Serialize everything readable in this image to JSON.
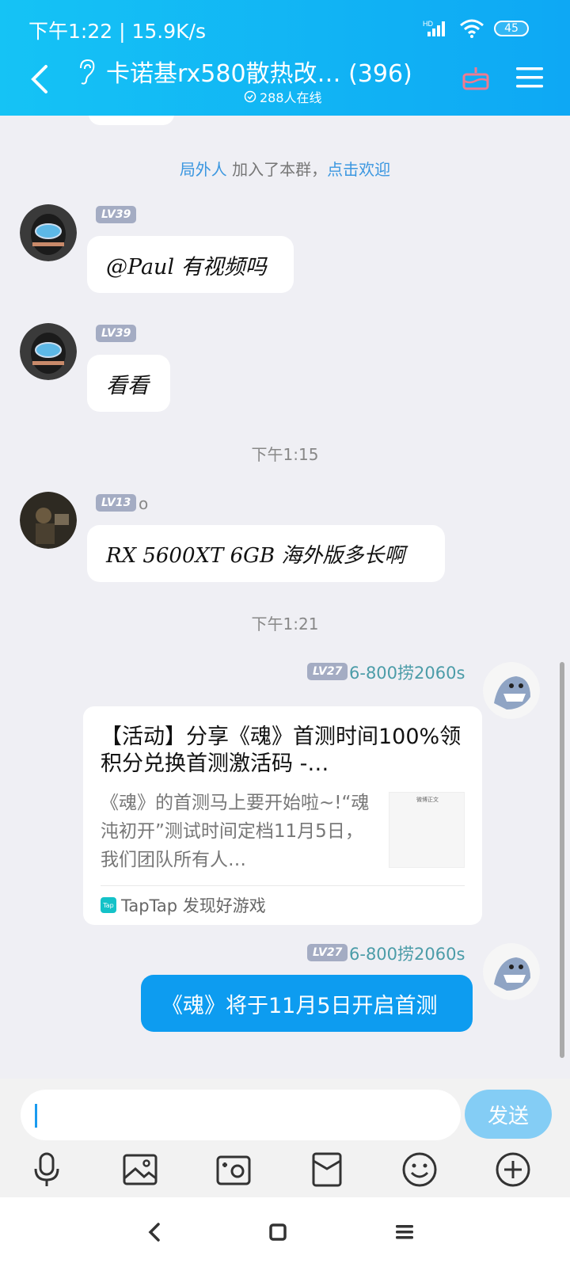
{
  "status": {
    "time_speed": "下午1:22 | 15.9K/s",
    "battery": "45",
    "signal": "HD"
  },
  "header": {
    "title": "卡诺基rx580散热改… (396)",
    "online": "288人在线"
  },
  "system_message": {
    "user": "局外人",
    "text": " 加入了本群，",
    "action": "点击欢迎"
  },
  "messages": [
    {
      "level": "LV39",
      "nick": "",
      "text": "@Paul 有视频吗"
    },
    {
      "level": "LV39",
      "nick": "",
      "text": "看看"
    },
    {
      "time": "下午1:15"
    },
    {
      "level": "LV13",
      "nick": "o",
      "text": "RX 5600XT 6GB 海外版多长啊"
    },
    {
      "time": "下午1:21"
    }
  ],
  "card_message": {
    "level": "LV27",
    "nick": "6-800捞2060s",
    "title": "【活动】分享《魂》首测时间100%领积分兑换首测激活码 -…",
    "desc": "《魂》的首测马上要开始啦~!“魂沌初开”测试时间定档11月5日，我们团队所有人…",
    "thumb_title": "微博正文",
    "source": "TapTap 发现好游戏",
    "source_logo": "Tap"
  },
  "last_message": {
    "level": "LV27",
    "nick": "6-800捞2060s",
    "text": "《魂》将于11月5日开启首测"
  },
  "input": {
    "value": "",
    "send_label": "发送"
  },
  "colors": {
    "header_start": "#15c3f5",
    "header_end": "#0ea8f4",
    "bubble_blue": "#0d9cf0",
    "send_btn": "#84cdf5"
  }
}
